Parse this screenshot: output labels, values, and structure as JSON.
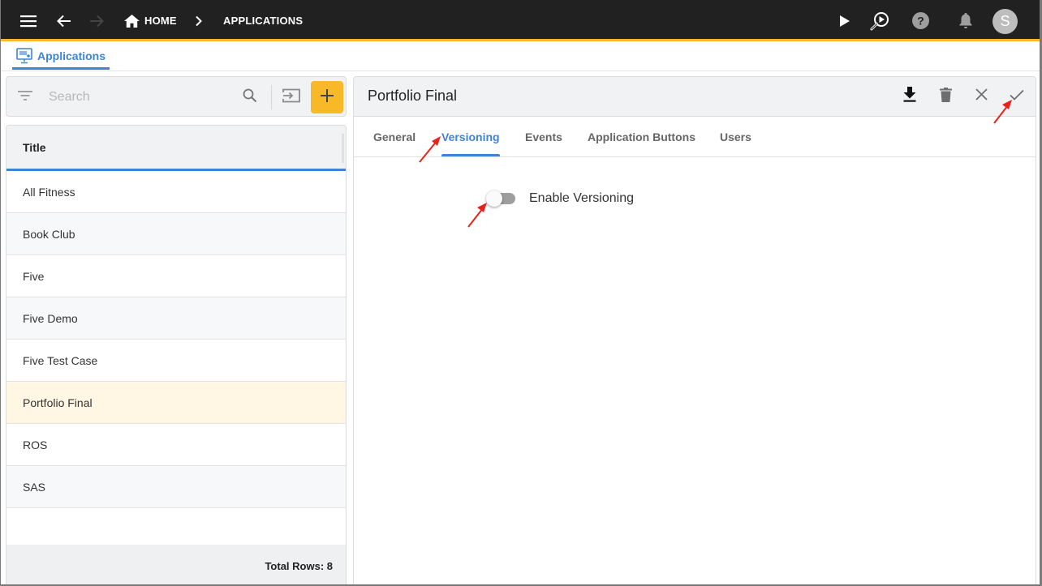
{
  "topbar": {
    "menu_icon": "hamburger-menu-icon",
    "back_icon": "arrow-back-icon",
    "forward_icon": "arrow-forward-icon",
    "breadcrumb": [
      {
        "label": "HOME",
        "icon": "home-icon"
      },
      {
        "label": "APPLICATIONS"
      }
    ],
    "breadcrumb_separator_icon": "chevron-right-icon",
    "actions": [
      "play-icon",
      "search-play-icon",
      "help-icon",
      "bell-icon"
    ],
    "avatar_initial": "S"
  },
  "app_tab": {
    "label": "Applications",
    "icon": "monitor-settings-icon"
  },
  "list_panel": {
    "search": {
      "placeholder": "Search",
      "value": ""
    },
    "filter_icon": "filter-icon",
    "search_icon": "search-icon",
    "import_icon": "import-icon",
    "add_icon": "plus-icon",
    "column_header": "Title",
    "rows": [
      {
        "title": "All Fitness",
        "selected": false
      },
      {
        "title": "Book Club",
        "selected": false
      },
      {
        "title": "Five",
        "selected": false
      },
      {
        "title": "Five Demo",
        "selected": false
      },
      {
        "title": "Five Test Case",
        "selected": false
      },
      {
        "title": "Portfolio Final",
        "selected": true
      },
      {
        "title": "ROS",
        "selected": false
      },
      {
        "title": "SAS",
        "selected": false
      }
    ],
    "footer": "Total Rows: 8"
  },
  "detail_panel": {
    "title": "Portfolio Final",
    "actions": [
      "download-icon",
      "delete-icon",
      "close-icon",
      "check-icon"
    ],
    "tabs": [
      {
        "label": "General",
        "active": false
      },
      {
        "label": "Versioning",
        "active": true
      },
      {
        "label": "Events",
        "active": false
      },
      {
        "label": "Application Buttons",
        "active": false
      },
      {
        "label": "Users",
        "active": false
      }
    ],
    "versioning": {
      "toggle_label": "Enable Versioning",
      "enabled": false
    }
  },
  "colors": {
    "topbar_bg": "#212121",
    "accent_yellow": "#f7b928",
    "accent_blue": "#3f84d4",
    "selected_row": "#fff6e3",
    "annotation_arrow": "#e8231a"
  }
}
